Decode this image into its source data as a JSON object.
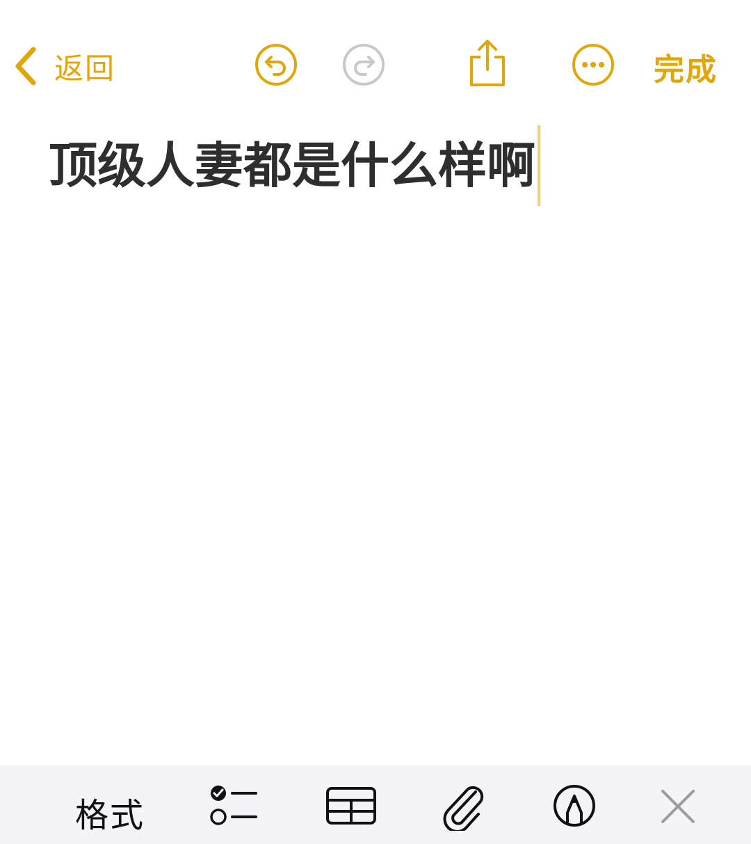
{
  "toolbar_top": {
    "back_label": "返回",
    "done_label": "完成",
    "icons": [
      "chevron-left-icon",
      "undo-icon",
      "redo-icon",
      "share-icon",
      "more-icon"
    ],
    "accent_color": "#E2A60B",
    "disabled_color": "#C8C8C8"
  },
  "note": {
    "title": "顶级人妻都是什么样啊"
  },
  "toolbar_bottom": {
    "format_label": "格式",
    "icons": [
      "checklist-icon",
      "table-icon",
      "paperclip-icon",
      "markup-pen-icon",
      "close-icon"
    ],
    "background": "#F3F3F8"
  }
}
